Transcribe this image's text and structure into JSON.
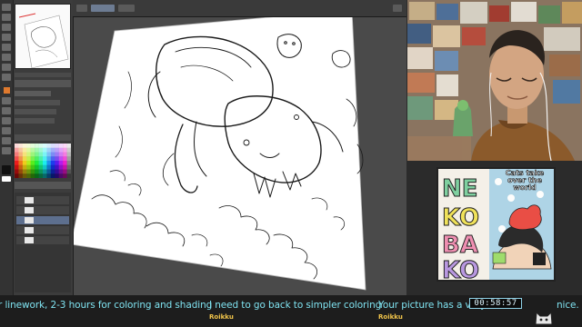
{
  "chat": {
    "messages": [
      {
        "text": "r linework, 2-3 hours for coloring and shading",
        "user": ""
      },
      {
        "text": "I need to go back to simpler coloring",
        "user": "Roikku"
      },
      {
        "text": "Your picture has a very co",
        "text_tail": "nice.",
        "user": "Roikku"
      }
    ]
  },
  "timer": {
    "value": "00:58:57"
  },
  "art_card": {
    "title": "Cats take over the world",
    "letters": [
      "NE",
      "KO",
      "BA",
      "KO"
    ]
  },
  "layers": [
    {
      "label": "",
      "selected": false
    },
    {
      "label": "",
      "selected": false
    },
    {
      "label": "",
      "selected": true
    },
    {
      "label": "",
      "selected": false
    },
    {
      "label": "",
      "selected": false
    }
  ],
  "colors": {
    "chat_text": "#7fe3f1",
    "chat_user": "#f3c64b",
    "panel": "#3c3c3c",
    "accent_tool": "#e07a2e"
  }
}
